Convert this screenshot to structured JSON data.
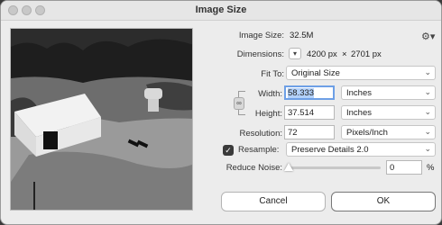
{
  "window": {
    "title": "Image Size"
  },
  "image_size": {
    "label": "Image Size:",
    "value": "32.5M"
  },
  "dimensions": {
    "label": "Dimensions:",
    "width": "4200 px",
    "times": "×",
    "height": "2701 px"
  },
  "fit_to": {
    "label": "Fit To:",
    "value": "Original Size"
  },
  "width": {
    "label": "Width:",
    "value": "58.333",
    "unit": "Inches"
  },
  "height": {
    "label": "Height:",
    "value": "37.514",
    "unit": "Inches"
  },
  "resolution": {
    "label": "Resolution:",
    "value": "72",
    "unit": "Pixels/Inch"
  },
  "resample": {
    "label": "Resample:",
    "checked": true,
    "method": "Preserve Details 2.0"
  },
  "reduce_noise": {
    "label": "Reduce Noise:",
    "value": "0",
    "unit": "%",
    "level": 0
  },
  "buttons": {
    "cancel": "Cancel",
    "ok": "OK"
  },
  "icons": {
    "gear": "gear-icon",
    "chain": "chain-link-icon",
    "chevron": "chevron-down-icon",
    "check": "checkmark-icon"
  }
}
